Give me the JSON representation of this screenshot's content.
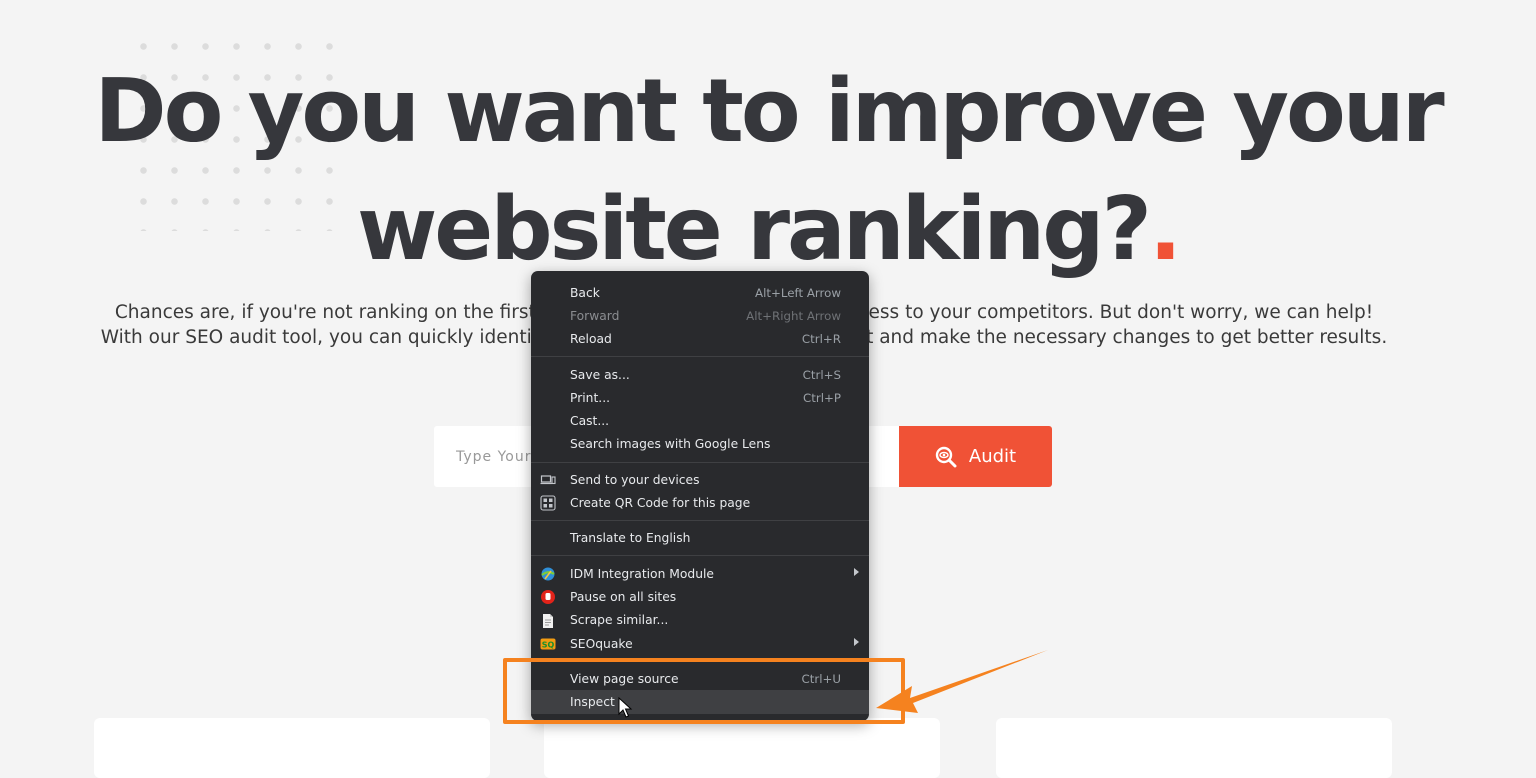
{
  "hero": {
    "title_line1": "Do you want to improve your",
    "title_line2": "website ranking?",
    "title_accent": ".",
    "description": "Chances are, if you're not ranking on the first page of Google, you're losing business to your competitors. But don't worry, we can help! With our SEO audit tool, you can quickly identify where your website is falling short and make the necessary changes to get better results."
  },
  "search": {
    "placeholder": "Type Your Website URL",
    "button_label": "Audit"
  },
  "context_menu": {
    "groups": [
      [
        {
          "label": "Back",
          "shortcut": "Alt+Left Arrow",
          "disabled": false
        },
        {
          "label": "Forward",
          "shortcut": "Alt+Right Arrow",
          "disabled": true
        },
        {
          "label": "Reload",
          "shortcut": "Ctrl+R",
          "disabled": false
        }
      ],
      [
        {
          "label": "Save as...",
          "shortcut": "Ctrl+S",
          "disabled": false
        },
        {
          "label": "Print...",
          "shortcut": "Ctrl+P",
          "disabled": false
        },
        {
          "label": "Cast...",
          "shortcut": "",
          "disabled": false
        },
        {
          "label": "Search images with Google Lens",
          "shortcut": "",
          "disabled": false
        }
      ],
      [
        {
          "label": "Send to your devices",
          "shortcut": "",
          "icon": "devices-icon",
          "disabled": false
        },
        {
          "label": "Create QR Code for this page",
          "shortcut": "",
          "icon": "qr-code-icon",
          "disabled": false
        }
      ],
      [
        {
          "label": "Translate to English",
          "shortcut": "",
          "disabled": false
        }
      ],
      [
        {
          "label": "IDM Integration Module",
          "shortcut": "",
          "icon": "idm-icon",
          "submenu": true,
          "disabled": false
        },
        {
          "label": "Pause on all sites",
          "shortcut": "",
          "icon": "stop-hand-icon",
          "disabled": false
        },
        {
          "label": "Scrape similar...",
          "shortcut": "",
          "icon": "scraper-icon",
          "disabled": false
        },
        {
          "label": "SEOquake",
          "shortcut": "",
          "icon": "seoquake-icon",
          "submenu": true,
          "disabled": false
        }
      ],
      [
        {
          "label": "View page source",
          "shortcut": "Ctrl+U",
          "disabled": false
        },
        {
          "label": "Inspect",
          "shortcut": "",
          "highlighted": true,
          "disabled": false
        }
      ]
    ]
  },
  "colors": {
    "accent": "#f05236",
    "annotation": "#f5821f",
    "menu_bg": "#292a2d",
    "page_bg": "#f4f4f4"
  }
}
